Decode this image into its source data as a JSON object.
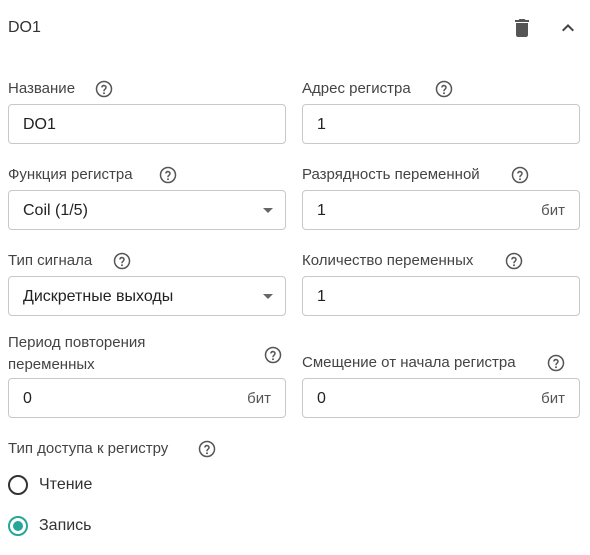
{
  "header": {
    "title": "DO1"
  },
  "fields": {
    "name": {
      "label": "Название",
      "value": "DO1"
    },
    "register_address": {
      "label": "Адрес регистра",
      "value": "1"
    },
    "register_function": {
      "label": "Функция регистра",
      "value": "Coil (1/5)"
    },
    "variable_bit_depth": {
      "label": "Разрядность переменной",
      "value": "1",
      "unit": "бит"
    },
    "signal_type": {
      "label": "Тип сигнала",
      "value": "Дискретные выходы"
    },
    "variable_count": {
      "label": "Количество переменных",
      "value": "1"
    },
    "repeat_period": {
      "label": "Период повторения переменных",
      "value": "0",
      "unit": "бит"
    },
    "register_offset": {
      "label": "Смещение от начала регистра",
      "value": "0",
      "unit": "бит"
    }
  },
  "access_type": {
    "label": "Тип доступа к регистру",
    "options": [
      {
        "label": "Чтение",
        "selected": false
      },
      {
        "label": "Запись",
        "selected": true
      }
    ]
  },
  "colors": {
    "accent": "#26a69a",
    "border": "#c8c8c8",
    "icon": "#555555"
  },
  "icons": {
    "delete": "trash-icon",
    "collapse": "chevron-up-icon",
    "help": "help-circle-icon"
  }
}
